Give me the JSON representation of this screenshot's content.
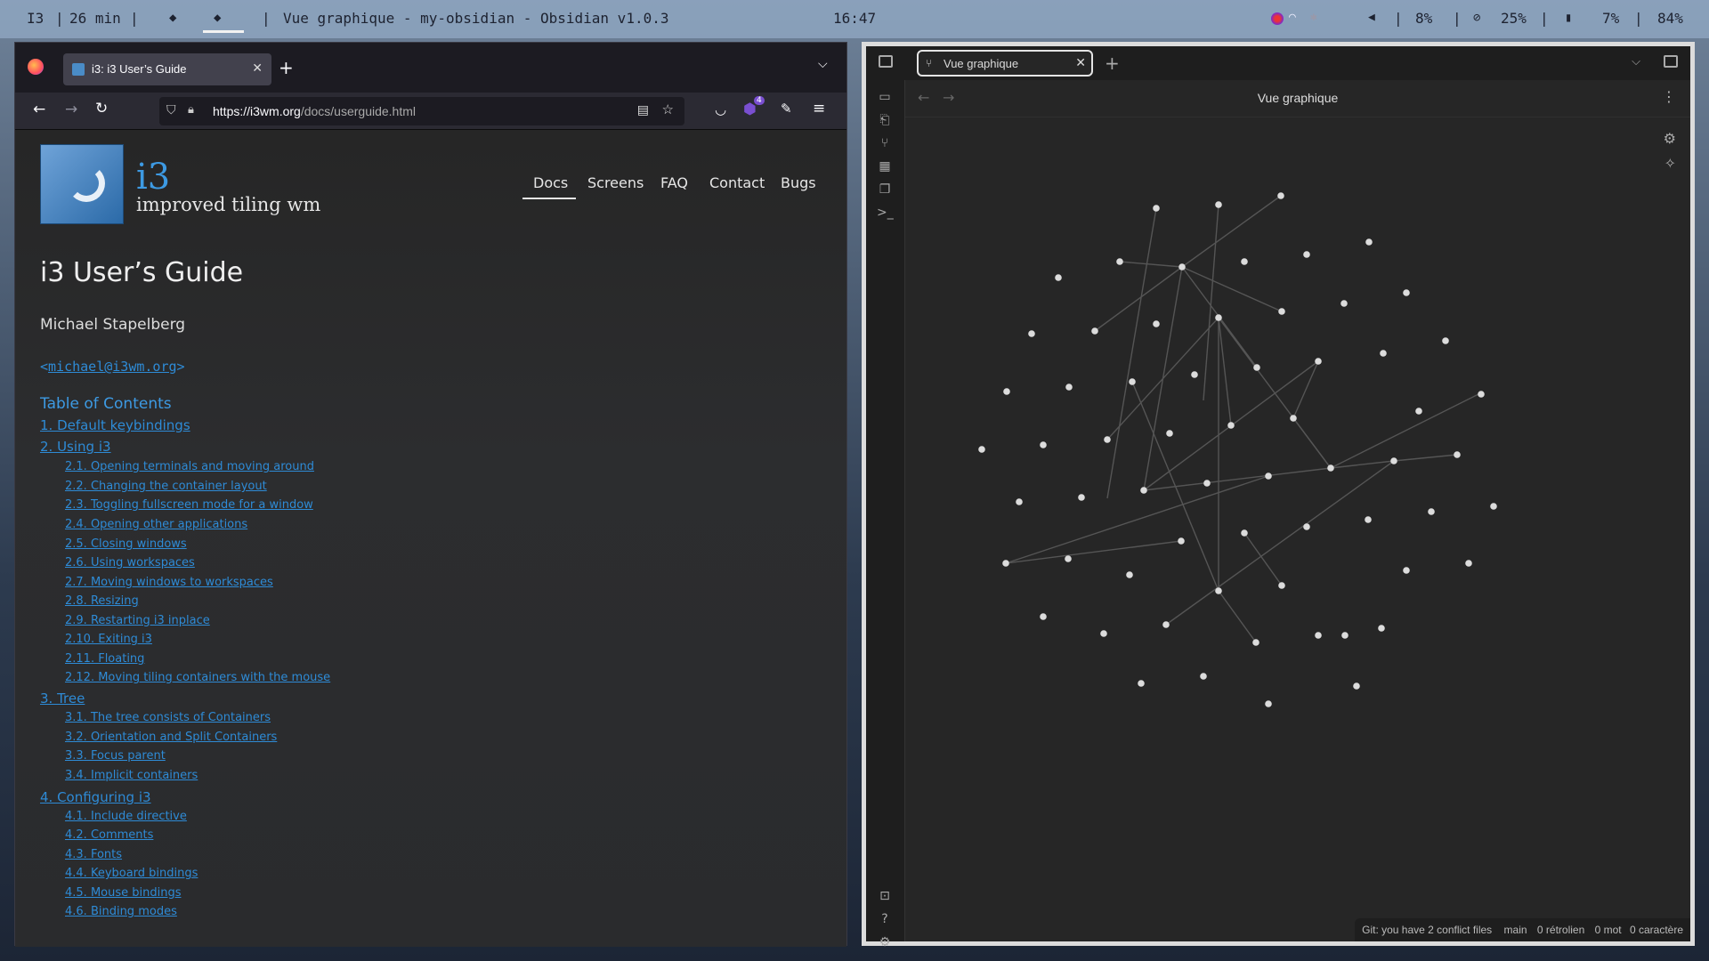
{
  "topbar": {
    "wm_name": "I3",
    "uptime": "26 min",
    "window_title": "Vue graphique - my-obsidian - Obsidian v1.0.3",
    "clock": "16:47",
    "volume": "8%",
    "cpu": "25%",
    "memory": "7%",
    "battery": "84%",
    "separator": "|"
  },
  "firefox": {
    "tab_title": "i3: i3 User’s Guide",
    "url_domain": "https://i3wm.org",
    "url_path": "/docs/userguide.html",
    "extension_badge": "4",
    "page": {
      "logo_title": "i3",
      "logo_subtitle": "improved tiling wm",
      "nav": [
        "Docs",
        "Screens",
        "FAQ",
        "Contact",
        "Bugs"
      ],
      "heading": "i3 User’s Guide",
      "author": "Michael Stapelberg",
      "email_lt": "<",
      "email": "michael@i3wm.org",
      "email_gt": ">",
      "toc_title": "Table of Contents",
      "toc": [
        "1. Default keybindings",
        "2. Using i3",
        "2.1. Opening terminals and moving around",
        "2.2. Changing the container layout",
        "2.3. Toggling fullscreen mode for a window",
        "2.4. Opening other applications",
        "2.5. Closing windows",
        "2.6. Using workspaces",
        "2.7. Moving windows to workspaces",
        "2.8. Resizing",
        "2.9. Restarting i3 inplace",
        "2.10. Exiting i3",
        "2.11. Floating",
        "2.12. Moving tiling containers with the mouse",
        "3. Tree",
        "3.1. The tree consists of Containers",
        "3.2. Orientation and Split Containers",
        "3.3. Focus parent",
        "3.4. Implicit containers",
        "4. Configuring i3",
        "4.1. Include directive",
        "4.2. Comments",
        "4.3. Fonts",
        "4.4. Keyboard bindings",
        "4.5. Mouse bindings",
        "4.6. Binding modes"
      ]
    }
  },
  "obsidian": {
    "tab_title": "Vue graphique",
    "view_title": "Vue graphique",
    "status": {
      "git": "Git: you have 2 conflict files",
      "branch": "main",
      "backlinks": "0 rétrolien",
      "words": "0 mot",
      "chars": "0 caractère"
    }
  }
}
